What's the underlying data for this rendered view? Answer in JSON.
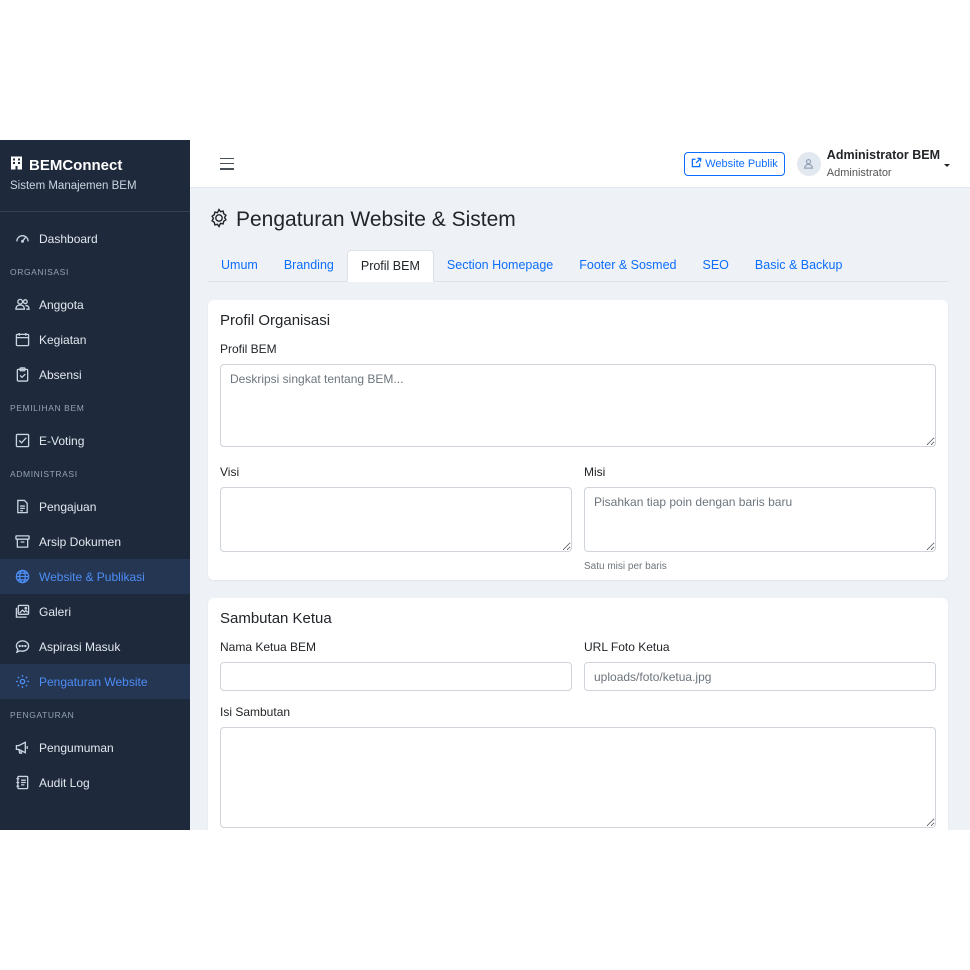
{
  "brand": {
    "title": "BEMConnect",
    "subtitle": "Sistem Manajemen BEM"
  },
  "sidebar": {
    "dashboard": "Dashboard",
    "section_organisasi": "ORGANISASI",
    "anggota": "Anggota",
    "kegiatan": "Kegiatan",
    "absensi": "Absensi",
    "section_pemilihan": "PEMILIHAN BEM",
    "evoting": "E-Voting",
    "section_administrasi": "ADMINISTRASI",
    "pengajuan": "Pengajuan",
    "arsip": "Arsip Dokumen",
    "website": "Website & Publikasi",
    "galeri": "Galeri",
    "aspirasi": "Aspirasi Masuk",
    "pengaturan_website": "Pengaturan Website",
    "section_pengaturan": "PENGATURAN",
    "pengumuman": "Pengumuman",
    "audit": "Audit Log"
  },
  "topbar": {
    "public_button": "Website Publik",
    "user_name": "Administrator BEM",
    "user_role": "Administrator"
  },
  "page": {
    "title": "Pengaturan Website & Sistem"
  },
  "tabs": [
    "Umum",
    "Branding",
    "Profil BEM",
    "Section Homepage",
    "Footer & Sosmed",
    "SEO",
    "Basic & Backup"
  ],
  "profil": {
    "heading": "Profil Organisasi",
    "profil_label": "Profil BEM",
    "profil_placeholder": "Deskripsi singkat tentang BEM...",
    "visi_label": "Visi",
    "misi_label": "Misi",
    "misi_placeholder": "Pisahkan tiap poin dengan baris baru",
    "misi_help": "Satu misi per baris"
  },
  "sambutan": {
    "heading": "Sambutan Ketua",
    "nama_label": "Nama Ketua BEM",
    "foto_label": "URL Foto Ketua",
    "foto_placeholder": "uploads/foto/ketua.jpg",
    "isi_label": "Isi Sambutan"
  },
  "colors": {
    "sidebar_bg": "#1e293b",
    "accent": "#0d6efd",
    "active_nav": "#4d8df6",
    "main_bg": "#eef2f6"
  }
}
